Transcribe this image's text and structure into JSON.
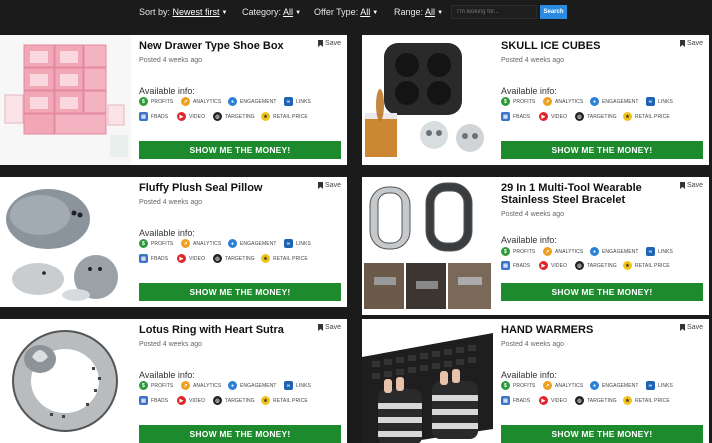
{
  "filters": {
    "sort_label": "Sort by:",
    "sort_value": "Newest first",
    "category_label": "Category:",
    "category_value": "All",
    "offer_label": "Offer Type:",
    "offer_value": "All",
    "range_label": "Range:",
    "range_value": "All",
    "search_placeholder": "I'm looking for...",
    "search_button": "Search"
  },
  "common": {
    "save_label": "Save",
    "available_label": "Available info:",
    "cta_label": "SHOW ME THE MONEY!",
    "info_labels": {
      "profits": "PROFITS",
      "analytics": "ANALYTICS",
      "engagement": "ENGAGEMENT",
      "links": "LINKS",
      "fbads": "FBADS",
      "video": "VIDEO",
      "targeting": "TARGETING",
      "retail_price": "RETAIL PRICE"
    }
  },
  "products": [
    {
      "title": "New Drawer Type Shoe Box",
      "posted": "Posted 4 weeks ago"
    },
    {
      "title": "SKULL ICE CUBES",
      "posted": "Posted 4 weeks ago"
    },
    {
      "title": "Fluffy Plush Seal Pillow",
      "posted": "Posted 4 weeks ago"
    },
    {
      "title": "29 In 1 Multi-Tool Wearable Stainless Steel Bracelet",
      "posted": "Posted 4 weeks ago"
    },
    {
      "title": "Lotus Ring with Heart Sutra",
      "posted": "Posted 4 weeks ago"
    },
    {
      "title": "HAND WARMERS",
      "posted": "Posted 4 weeks ago"
    }
  ],
  "colors": {
    "cta_green": "#1e8a2e",
    "search_blue": "#2a8be0",
    "page_bg": "#1b1b1b",
    "profits": "#2e9b3a",
    "analytics": "#f0a020",
    "engagement": "#2b7fd4",
    "links": "#1f63b5",
    "fbads": "#3b73c8",
    "video": "#e0262b",
    "targeting": "#222222",
    "retail_price": "#f2c418"
  }
}
